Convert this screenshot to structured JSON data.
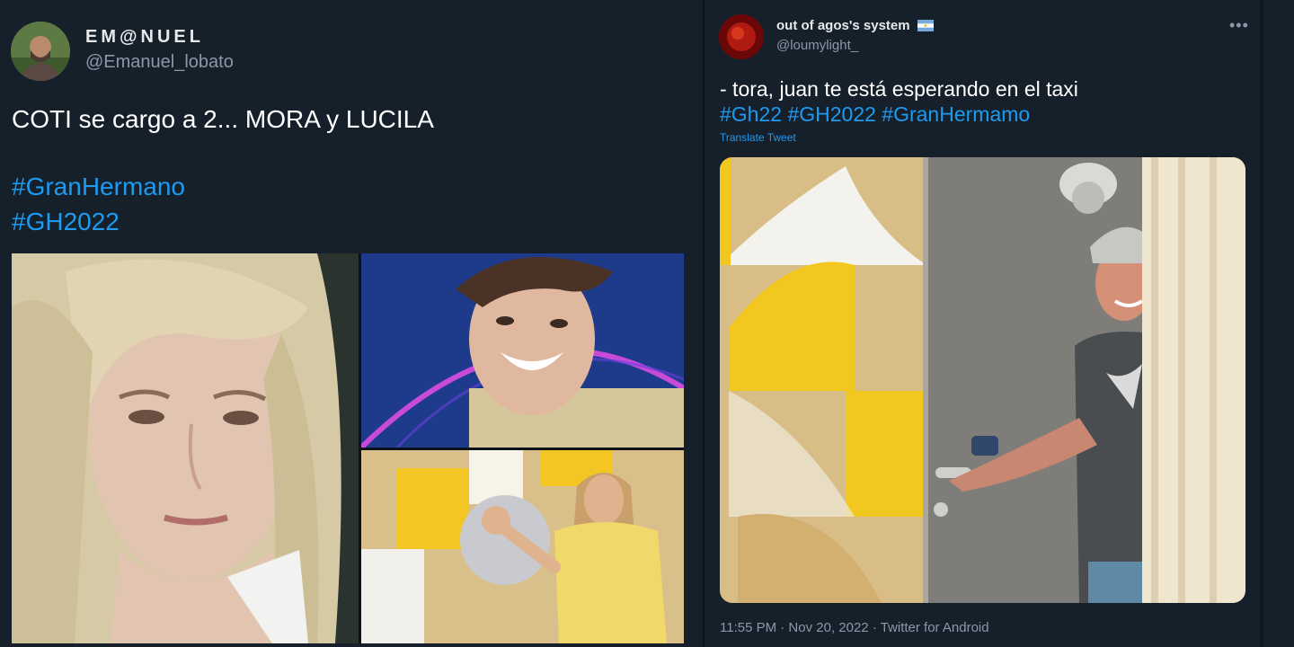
{
  "left_tweet": {
    "display_name": "EM@NUEL",
    "handle": "@Emanuel_lobato",
    "text": "COTI se cargo a 2... MORA y LUCILA",
    "hashtags": [
      "#GranHermano",
      "#GH2022"
    ]
  },
  "right_tweet": {
    "display_name": "out of agos's system",
    "handle": "@loumylight_",
    "more_icon": "more-horizontal-icon",
    "flag_icon": "argentina-flag-icon",
    "text": "- tora, juan te está esperando en el taxi",
    "hashtags": "#Gh22 #GH2022 #GranHermamo",
    "translate_label": "Translate Tweet",
    "meta": "11:55 PM · Nov 20, 2022 · Twitter for Android"
  },
  "colors": {
    "background": "#15202b",
    "link": "#1d9bf0",
    "secondary_text": "#8b98a5"
  }
}
